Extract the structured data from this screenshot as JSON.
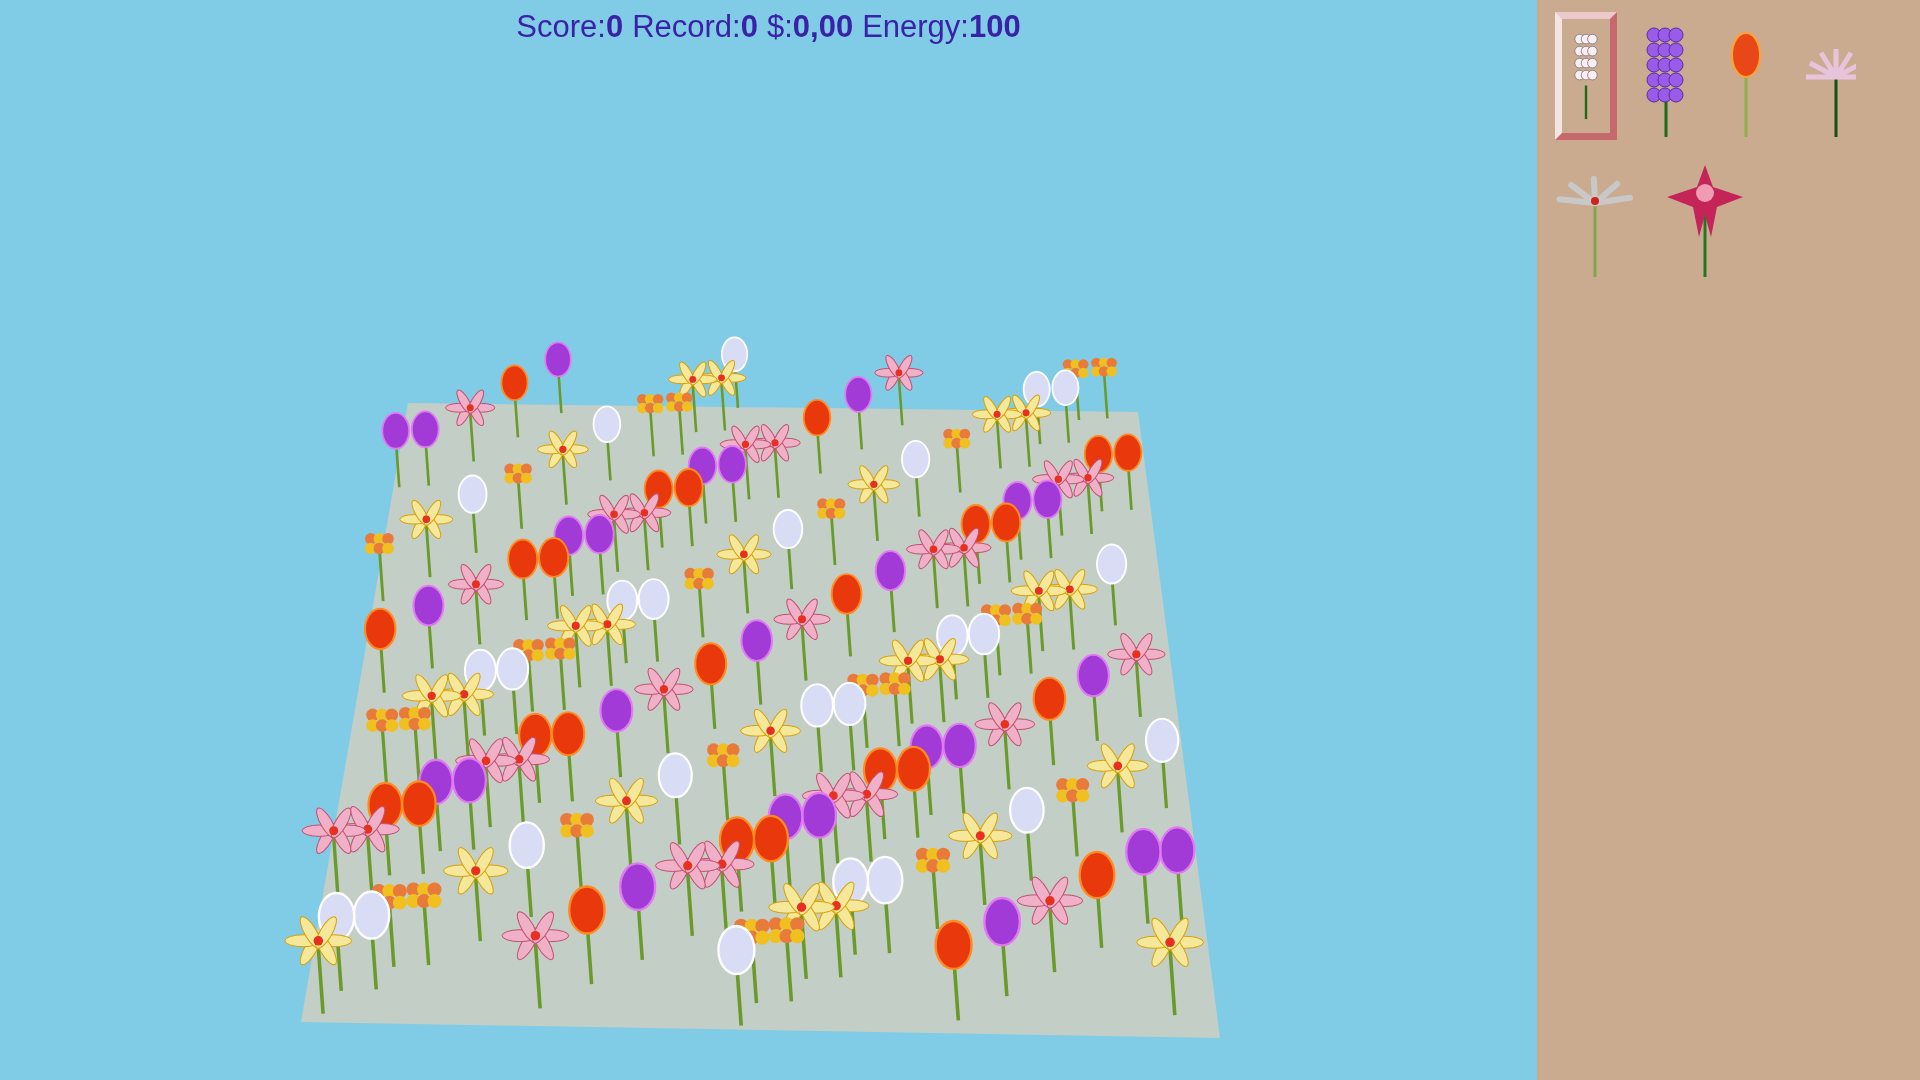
{
  "hud": [
    {
      "label": "Score:",
      "value": "0"
    },
    {
      "label": "Record:",
      "value": "0"
    },
    {
      "label": "$:",
      "value": "0,00"
    },
    {
      "label": "Energy:",
      "value": "100"
    }
  ],
  "palette": [
    {
      "kind": "white-hyacinth",
      "selected": true
    },
    {
      "kind": "purple-hyacinth",
      "selected": false
    },
    {
      "kind": "tulip",
      "selected": false
    },
    {
      "kind": "nerine",
      "selected": false
    },
    {
      "kind": "lily",
      "selected": false
    },
    {
      "kind": "star-flower",
      "selected": false
    }
  ]
}
